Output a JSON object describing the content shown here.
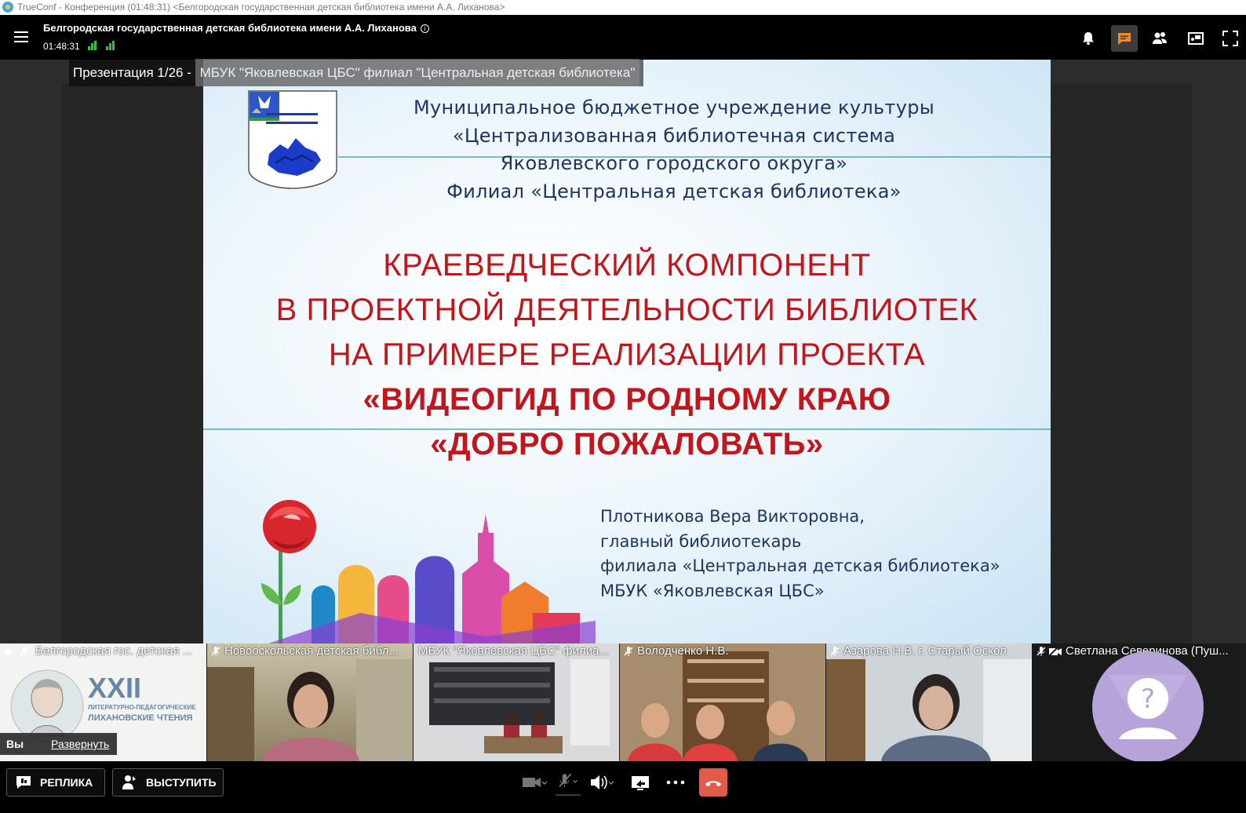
{
  "window": {
    "title": "TrueConf - Конференция (01:48:31) <Белгородская государственная детская библиотека имени А.А. Лиханова>"
  },
  "header": {
    "conference_title": "Белгородская государственная детская библиотека имени А.А. Лиханова",
    "time": "01:48:31",
    "icons": [
      "menu-icon",
      "info-icon",
      "signal-icon",
      "bell-icon",
      "chat-icon",
      "participants-icon",
      "layout-icon",
      "fullscreen-icon"
    ]
  },
  "presentation": {
    "caption_prefix": "Презентация 1/26 - ",
    "caption_source": "МБУК \"Яковлевская ЦБС\" филиал \"Центральная детская библиотека\"",
    "org_lines": [
      "Муниципальное бюджетное учреждение культуры",
      "«Централизованная библиотечная система",
      "Яковлевского городского округа»",
      "Филиал «Центральная детская библиотека»"
    ],
    "heading_lines": [
      "КРАЕВЕДЧЕСКИЙ КОМПОНЕНТ",
      "В ПРОЕКТНОЙ ДЕЯТЕЛЬНОСТИ БИБЛИОТЕК",
      "НА ПРИМЕРЕ РЕАЛИЗАЦИИ ПРОЕКТА",
      "«ВИДЕОГИД ПО РОДНОМУ КРАЮ",
      "«ДОБРО ПОЖАЛОВАТЬ»"
    ],
    "author_lines": [
      "Плотникова Вера Викторовна,",
      "главный библиотекарь",
      "филиала «Центральная детская библиотека»",
      "МБУК «Яковлевская ЦБС»"
    ],
    "colors": {
      "heading": "#c0161c",
      "org_text": "#1d3560"
    }
  },
  "participants": [
    {
      "name": "Белгородская гос. детская ...",
      "poster": {
        "roman": "XXII",
        "line1": "ЛИТЕРАТУРНО-ПЕДАГОГИЧЕСКИЕ",
        "line2": "ЛИХАНОВСКИЕ ЧТЕНИЯ"
      },
      "you_label": "Вы",
      "expand_label": "Развернуть"
    },
    {
      "name": "Новооскольская детская библ..."
    },
    {
      "name": "МБУК \"Яковлевская ЦБС\" филиа..."
    },
    {
      "name": "Володченко Н.В."
    },
    {
      "name": "Азарова Н.В. г. Старый Оскол"
    },
    {
      "name": "Светлана Северинова (Пуш..."
    }
  ],
  "bottombar": {
    "reply_label": "РЕПЛИКА",
    "speak_label": "ВЫСТУПИТЬ",
    "controls": [
      "camera-icon",
      "microphone-icon",
      "speaker-icon",
      "share-screen-icon",
      "more-icon",
      "hangup-icon"
    ]
  }
}
